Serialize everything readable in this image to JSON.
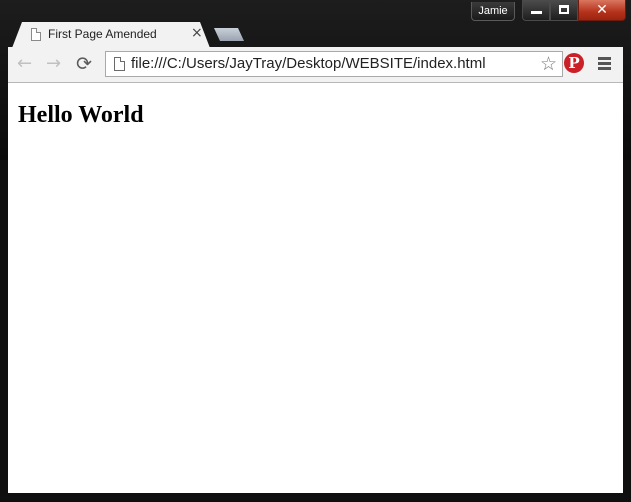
{
  "window": {
    "profile_name": "Jamie",
    "close_glyph": "✕"
  },
  "tabs": [
    {
      "title": "First Page Amended",
      "close_glyph": "×",
      "icon": "page-icon"
    }
  ],
  "toolbar": {
    "back_glyph": "←",
    "forward_glyph": "→",
    "reload_glyph": "⟳",
    "url": "file:///C:/Users/JayTray/Desktop/WEBSITE/index.html",
    "star_glyph": "☆",
    "pinterest_glyph": "P",
    "pinterest_color": "#cb2027"
  },
  "page": {
    "heading": "Hello World"
  }
}
